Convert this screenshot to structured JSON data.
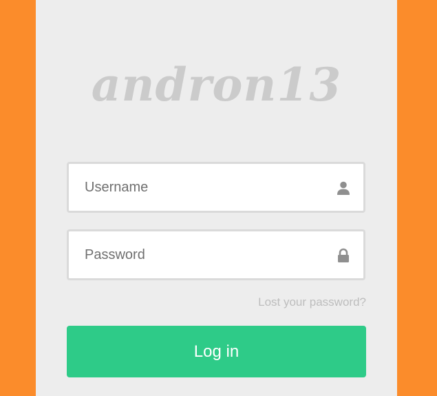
{
  "logo": {
    "text": "andron13"
  },
  "form": {
    "username_placeholder": "Username",
    "username_icon": "user-icon",
    "password_placeholder": "Password",
    "password_icon": "lock-icon",
    "lost_password": "Lost your password?",
    "login_label": "Log in"
  },
  "colors": {
    "background": "#fb8c2b",
    "panel": "#ededed",
    "button": "#2ecb88",
    "logo": "#cbcbcb"
  }
}
